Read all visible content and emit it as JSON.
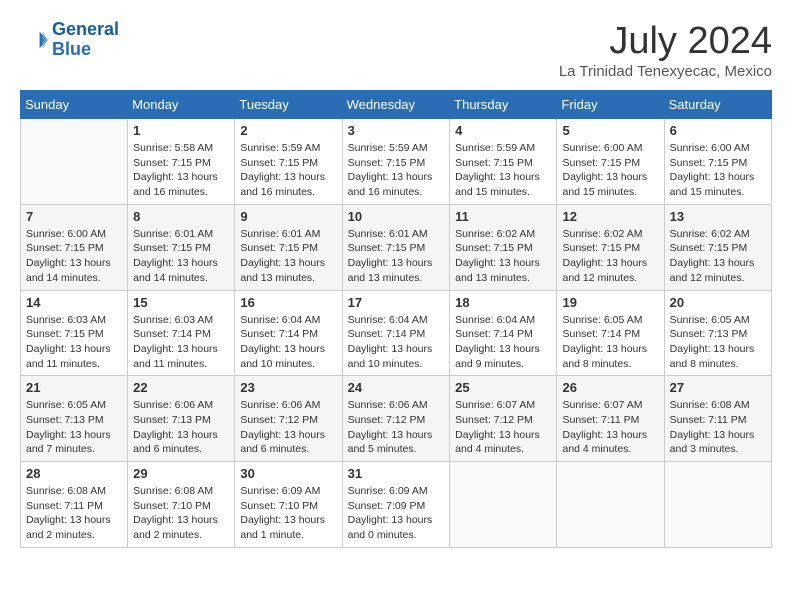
{
  "header": {
    "logo_line1": "General",
    "logo_line2": "Blue",
    "month": "July 2024",
    "location": "La Trinidad Tenexyecac, Mexico"
  },
  "calendar": {
    "days_of_week": [
      "Sunday",
      "Monday",
      "Tuesday",
      "Wednesday",
      "Thursday",
      "Friday",
      "Saturday"
    ],
    "weeks": [
      [
        {
          "day": "",
          "info": ""
        },
        {
          "day": "1",
          "info": "Sunrise: 5:58 AM\nSunset: 7:15 PM\nDaylight: 13 hours\nand 16 minutes."
        },
        {
          "day": "2",
          "info": "Sunrise: 5:59 AM\nSunset: 7:15 PM\nDaylight: 13 hours\nand 16 minutes."
        },
        {
          "day": "3",
          "info": "Sunrise: 5:59 AM\nSunset: 7:15 PM\nDaylight: 13 hours\nand 16 minutes."
        },
        {
          "day": "4",
          "info": "Sunrise: 5:59 AM\nSunset: 7:15 PM\nDaylight: 13 hours\nand 15 minutes."
        },
        {
          "day": "5",
          "info": "Sunrise: 6:00 AM\nSunset: 7:15 PM\nDaylight: 13 hours\nand 15 minutes."
        },
        {
          "day": "6",
          "info": "Sunrise: 6:00 AM\nSunset: 7:15 PM\nDaylight: 13 hours\nand 15 minutes."
        }
      ],
      [
        {
          "day": "7",
          "info": ""
        },
        {
          "day": "8",
          "info": "Sunrise: 6:01 AM\nSunset: 7:15 PM\nDaylight: 13 hours\nand 14 minutes."
        },
        {
          "day": "9",
          "info": "Sunrise: 6:01 AM\nSunset: 7:15 PM\nDaylight: 13 hours\nand 13 minutes."
        },
        {
          "day": "10",
          "info": "Sunrise: 6:01 AM\nSunset: 7:15 PM\nDaylight: 13 hours\nand 13 minutes."
        },
        {
          "day": "11",
          "info": "Sunrise: 6:02 AM\nSunset: 7:15 PM\nDaylight: 13 hours\nand 13 minutes."
        },
        {
          "day": "12",
          "info": "Sunrise: 6:02 AM\nSunset: 7:15 PM\nDaylight: 13 hours\nand 12 minutes."
        },
        {
          "day": "13",
          "info": "Sunrise: 6:02 AM\nSunset: 7:15 PM\nDaylight: 13 hours\nand 12 minutes."
        }
      ],
      [
        {
          "day": "14",
          "info": ""
        },
        {
          "day": "15",
          "info": "Sunrise: 6:03 AM\nSunset: 7:14 PM\nDaylight: 13 hours\nand 11 minutes."
        },
        {
          "day": "16",
          "info": "Sunrise: 6:04 AM\nSunset: 7:14 PM\nDaylight: 13 hours\nand 10 minutes."
        },
        {
          "day": "17",
          "info": "Sunrise: 6:04 AM\nSunset: 7:14 PM\nDaylight: 13 hours\nand 10 minutes."
        },
        {
          "day": "18",
          "info": "Sunrise: 6:04 AM\nSunset: 7:14 PM\nDaylight: 13 hours\nand 9 minutes."
        },
        {
          "day": "19",
          "info": "Sunrise: 6:05 AM\nSunset: 7:14 PM\nDaylight: 13 hours\nand 8 minutes."
        },
        {
          "day": "20",
          "info": "Sunrise: 6:05 AM\nSunset: 7:13 PM\nDaylight: 13 hours\nand 8 minutes."
        }
      ],
      [
        {
          "day": "21",
          "info": ""
        },
        {
          "day": "22",
          "info": "Sunrise: 6:06 AM\nSunset: 7:13 PM\nDaylight: 13 hours\nand 6 minutes."
        },
        {
          "day": "23",
          "info": "Sunrise: 6:06 AM\nSunset: 7:12 PM\nDaylight: 13 hours\nand 6 minutes."
        },
        {
          "day": "24",
          "info": "Sunrise: 6:06 AM\nSunset: 7:12 PM\nDaylight: 13 hours\nand 5 minutes."
        },
        {
          "day": "25",
          "info": "Sunrise: 6:07 AM\nSunset: 7:12 PM\nDaylight: 13 hours\nand 4 minutes."
        },
        {
          "day": "26",
          "info": "Sunrise: 6:07 AM\nSunset: 7:11 PM\nDaylight: 13 hours\nand 4 minutes."
        },
        {
          "day": "27",
          "info": "Sunrise: 6:08 AM\nSunset: 7:11 PM\nDaylight: 13 hours\nand 3 minutes."
        }
      ],
      [
        {
          "day": "28",
          "info": "Sunrise: 6:08 AM\nSunset: 7:11 PM\nDaylight: 13 hours\nand 2 minutes."
        },
        {
          "day": "29",
          "info": "Sunrise: 6:08 AM\nSunset: 7:10 PM\nDaylight: 13 hours\nand 2 minutes."
        },
        {
          "day": "30",
          "info": "Sunrise: 6:09 AM\nSunset: 7:10 PM\nDaylight: 13 hours\nand 1 minute."
        },
        {
          "day": "31",
          "info": "Sunrise: 6:09 AM\nSunset: 7:09 PM\nDaylight: 13 hours\nand 0 minutes."
        },
        {
          "day": "",
          "info": ""
        },
        {
          "day": "",
          "info": ""
        },
        {
          "day": "",
          "info": ""
        }
      ]
    ],
    "week1_sunday_info": "Sunrise: 6:00 AM\nSunset: 7:15 PM\nDaylight: 13 hours\nand 14 minutes.",
    "week2_sunday_info": "Sunrise: 6:00 AM\nSunset: 7:15 PM\nDaylight: 13 hours\nand 14 minutes.",
    "week3_sunday_info": "Sunrise: 6:03 AM\nSunset: 7:15 PM\nDaylight: 13 hours\nand 11 minutes.",
    "week4_sunday_info": "Sunrise: 6:05 AM\nSunset: 7:13 PM\nDaylight: 13 hours\nand 7 minutes."
  }
}
